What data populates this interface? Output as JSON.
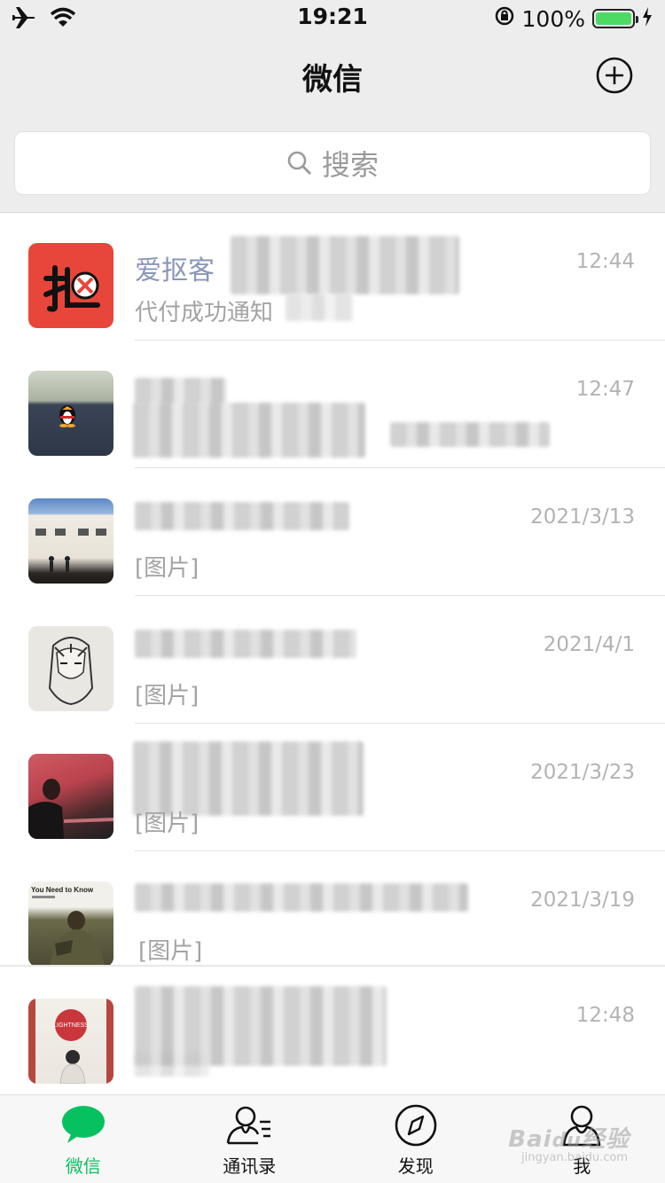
{
  "status_bar": {
    "time": "19:21",
    "battery": "100%"
  },
  "nav": {
    "title": "微信"
  },
  "search": {
    "placeholder": "搜索"
  },
  "chats": [
    {
      "name": "爱抠客",
      "preview": "代付成功通知",
      "time": "12:44"
    },
    {
      "name": "",
      "preview": "",
      "time": "12:47"
    },
    {
      "name": "",
      "preview": "[图片]",
      "time": "2021/3/13"
    },
    {
      "name": "",
      "preview": "[图片]",
      "time": "2021/4/1"
    },
    {
      "name": "",
      "preview": "[图片]",
      "time": "2021/3/23"
    },
    {
      "name": "",
      "preview": "[图片]",
      "time": "2021/3/19"
    },
    {
      "name": "",
      "preview": "",
      "time": "12:48"
    }
  ],
  "tabs": [
    {
      "label": "微信",
      "icon": "chat-bubble-icon"
    },
    {
      "label": "通讯录",
      "icon": "contacts-icon"
    },
    {
      "label": "发现",
      "icon": "compass-icon"
    },
    {
      "label": "我",
      "icon": "person-icon"
    }
  ],
  "colors": {
    "accent": "#07c160",
    "background": "#ededed"
  }
}
